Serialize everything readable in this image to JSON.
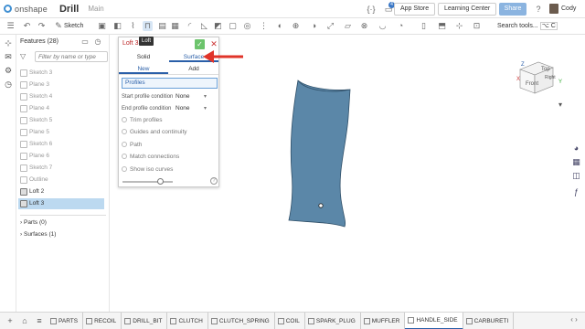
{
  "app": {
    "logo": "onshape",
    "doc_title": "Drill",
    "branch": "Main"
  },
  "topbar": {
    "notifications_count": "4",
    "app_store": "App Store",
    "learning_center": "Learning Center",
    "share": "Share",
    "user": "Cody"
  },
  "toolbar": {
    "sketch_label": "Sketch",
    "search_tools": "Search tools...",
    "search_shortcut": "⌥ C"
  },
  "features": {
    "header": "Features (28)",
    "filter_placeholder": "Filter by name or type",
    "items": [
      {
        "label": "Sketch 3"
      },
      {
        "label": "Plane 3"
      },
      {
        "label": "Sketch 4"
      },
      {
        "label": "Plane 4"
      },
      {
        "label": "Sketch 5"
      },
      {
        "label": "Plane 5"
      },
      {
        "label": "Sketch 6"
      },
      {
        "label": "Plane 6"
      },
      {
        "label": "Sketch 7"
      },
      {
        "label": "Outline"
      },
      {
        "label": "Loft 2"
      },
      {
        "label": "Loft 3"
      }
    ],
    "parts": "Parts (0)",
    "surfaces": "Surfaces (1)"
  },
  "dialog": {
    "title": "Loft 3",
    "tooltip": "Loft",
    "type_solid": "Solid",
    "type_surface": "Surface",
    "op_new": "New",
    "op_add": "Add",
    "profiles": "Profiles",
    "start_label": "Start profile condition",
    "start_value": "None",
    "end_label": "End profile condition",
    "end_value": "None",
    "options": [
      "Trim profiles",
      "Guides and continuity",
      "Path",
      "Match connections",
      "Show iso curves"
    ]
  },
  "viewcube": {
    "top": "Top",
    "front": "Front",
    "right": "Right",
    "axis_x": "X",
    "axis_y": "Y",
    "axis_z": "Z"
  },
  "tabs": [
    {
      "label": "PARTS"
    },
    {
      "label": "RECOIL"
    },
    {
      "label": "DRILL_BIT"
    },
    {
      "label": "CLUTCH"
    },
    {
      "label": "CLUTCH_SPRING"
    },
    {
      "label": "COIL"
    },
    {
      "label": "SPARK_PLUG"
    },
    {
      "label": "MUFFLER"
    },
    {
      "label": "HANDLE_SIDE"
    },
    {
      "label": "CARBURETI"
    }
  ],
  "colors": {
    "accent": "#2a5fa8",
    "surface": "#5b87a8",
    "arrow": "#e0342a"
  }
}
